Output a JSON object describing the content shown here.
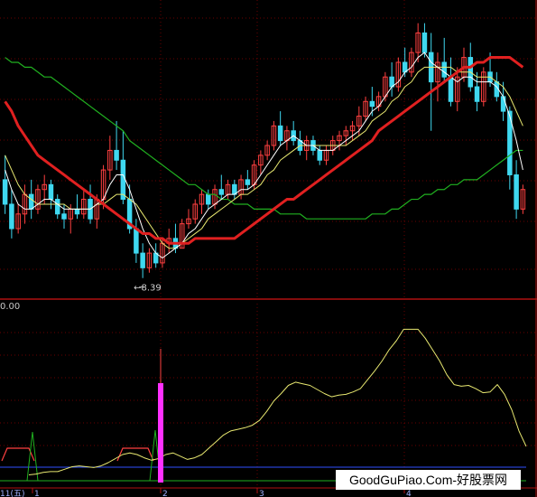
{
  "colors": {
    "up": "#ff4040",
    "down": "#3fd8f0",
    "ma_fast": "#ffffff",
    "ma_mid": "#e8e870",
    "ma_thick": "#e02020",
    "ma_long": "#20b020",
    "ind_line": "#e8e870",
    "ind_spike": "#ff30ff",
    "ind_red": "#ff4040",
    "ind_green": "#20b020",
    "grid": "#6a0000",
    "divider": "#b01010",
    "blue": "#3050ff"
  },
  "main": {
    "min_price_label": "8.39"
  },
  "indicator": {
    "value_label": "0.00"
  },
  "axis": {
    "left_label": "11(五)",
    "ticks": [
      "1",
      "2",
      "3",
      "4"
    ]
  },
  "watermark": "GoodGuPiao.Com-好股票网",
  "chart_data": [
    {
      "type": "candlestick",
      "candles": [
        [
          10.4,
          10.9,
          9.7,
          9.9
        ],
        [
          9.9,
          10.2,
          9.2,
          9.4
        ],
        [
          9.4,
          9.9,
          9.3,
          9.7
        ],
        [
          9.7,
          10.3,
          9.5,
          10.1
        ],
        [
          10.1,
          10.4,
          9.6,
          9.8
        ],
        [
          9.8,
          10.3,
          9.7,
          10.2
        ],
        [
          10.2,
          10.5,
          9.9,
          10.3
        ],
        [
          10.3,
          10.4,
          9.8,
          10.0
        ],
        [
          10.0,
          10.1,
          9.6,
          9.7
        ],
        [
          9.7,
          9.9,
          9.4,
          9.6
        ],
        [
          9.6,
          9.9,
          9.3,
          9.8
        ],
        [
          9.8,
          10.1,
          9.6,
          9.7
        ],
        [
          9.7,
          10.2,
          9.6,
          10.0
        ],
        [
          10.0,
          10.3,
          9.5,
          9.6
        ],
        [
          9.6,
          10.1,
          9.4,
          10.0
        ],
        [
          10.0,
          10.7,
          9.8,
          10.6
        ],
        [
          10.6,
          11.3,
          10.4,
          11.0
        ],
        [
          11.0,
          11.6,
          10.6,
          10.8
        ],
        [
          10.8,
          11.4,
          9.9,
          10.0
        ],
        [
          10.0,
          10.3,
          9.3,
          9.4
        ],
        [
          9.4,
          9.6,
          8.7,
          8.9
        ],
        [
          8.9,
          9.1,
          8.39,
          8.6
        ],
        [
          8.6,
          9.0,
          8.5,
          8.9
        ],
        [
          8.9,
          9.1,
          8.6,
          8.7
        ],
        [
          8.7,
          9.2,
          8.6,
          9.1
        ],
        [
          9.1,
          9.4,
          8.9,
          9.2
        ],
        [
          9.2,
          9.5,
          8.9,
          9.0
        ],
        [
          9.0,
          9.6,
          9.0,
          9.5
        ],
        [
          9.5,
          9.8,
          9.4,
          9.6
        ],
        [
          9.6,
          10.0,
          9.5,
          9.9
        ],
        [
          9.9,
          10.2,
          9.7,
          10.1
        ],
        [
          10.1,
          10.2,
          9.8,
          9.9
        ],
        [
          9.9,
          10.3,
          9.8,
          10.2
        ],
        [
          10.2,
          10.5,
          10.0,
          10.1
        ],
        [
          10.1,
          10.4,
          10.0,
          10.3
        ],
        [
          10.3,
          10.4,
          10.0,
          10.1
        ],
        [
          10.1,
          10.5,
          10.0,
          10.4
        ],
        [
          10.4,
          10.6,
          10.2,
          10.3
        ],
        [
          10.3,
          10.8,
          10.2,
          10.7
        ],
        [
          10.7,
          11.0,
          10.5,
          10.9
        ],
        [
          10.9,
          11.2,
          10.8,
          11.1
        ],
        [
          11.1,
          11.6,
          11.0,
          11.5
        ],
        [
          11.5,
          11.8,
          11.1,
          11.2
        ],
        [
          11.2,
          11.5,
          11.0,
          11.4
        ],
        [
          11.4,
          11.6,
          11.1,
          11.2
        ],
        [
          11.2,
          11.4,
          10.9,
          11.0
        ],
        [
          11.0,
          11.3,
          10.8,
          11.2
        ],
        [
          11.2,
          11.3,
          10.9,
          11.0
        ],
        [
          11.0,
          11.1,
          10.7,
          10.8
        ],
        [
          10.8,
          11.1,
          10.7,
          11.0
        ],
        [
          11.0,
          11.3,
          10.9,
          11.2
        ],
        [
          11.2,
          11.4,
          11.0,
          11.3
        ],
        [
          11.3,
          11.5,
          11.1,
          11.4
        ],
        [
          11.4,
          11.6,
          11.2,
          11.5
        ],
        [
          11.5,
          11.9,
          11.3,
          11.7
        ],
        [
          11.7,
          12.1,
          11.6,
          12.0
        ],
        [
          12.0,
          12.3,
          11.7,
          11.9
        ],
        [
          11.9,
          12.2,
          11.8,
          12.1
        ],
        [
          12.1,
          12.6,
          12.0,
          12.5
        ],
        [
          12.5,
          12.8,
          12.1,
          12.3
        ],
        [
          12.3,
          12.9,
          12.2,
          12.8
        ],
        [
          12.8,
          13.1,
          12.5,
          12.6
        ],
        [
          12.6,
          13.1,
          12.5,
          13.0
        ],
        [
          13.0,
          13.6,
          12.8,
          13.4
        ],
        [
          13.4,
          13.6,
          12.9,
          13.0
        ],
        [
          13.0,
          13.4,
          11.4,
          12.4
        ],
        [
          12.4,
          13.0,
          12.0,
          12.8
        ],
        [
          12.8,
          13.3,
          12.4,
          12.5
        ],
        [
          12.5,
          12.9,
          11.9,
          12.0
        ],
        [
          12.0,
          12.7,
          11.8,
          12.5
        ],
        [
          12.5,
          13.1,
          12.4,
          12.9
        ],
        [
          12.9,
          13.2,
          12.2,
          12.3
        ],
        [
          12.3,
          12.6,
          11.8,
          12.0
        ],
        [
          12.0,
          12.7,
          11.9,
          12.6
        ],
        [
          12.6,
          13.0,
          12.3,
          12.4
        ],
        [
          12.4,
          12.6,
          12.0,
          12.1
        ],
        [
          12.1,
          12.4,
          11.6,
          11.8
        ],
        [
          11.8,
          11.9,
          10.2,
          10.5
        ],
        [
          10.5,
          10.8,
          9.6,
          9.8
        ],
        [
          9.8,
          10.3,
          9.7,
          10.2
        ]
      ],
      "ma_fast": [
        10.6,
        10.2,
        9.9,
        9.8,
        9.8,
        9.9,
        10.0,
        10.0,
        9.9,
        9.8,
        9.8,
        9.8,
        9.8,
        9.8,
        9.9,
        10.0,
        10.3,
        10.5,
        10.5,
        10.2,
        9.8,
        9.4,
        9.1,
        8.9,
        8.8,
        8.9,
        9.0,
        9.1,
        9.3,
        9.4,
        9.6,
        9.8,
        9.9,
        10.0,
        10.1,
        10.1,
        10.2,
        10.2,
        10.3,
        10.5,
        10.7,
        10.9,
        11.1,
        11.2,
        11.3,
        11.2,
        11.1,
        11.1,
        11.0,
        11.0,
        11.0,
        11.1,
        11.2,
        11.3,
        11.4,
        11.6,
        11.8,
        11.9,
        12.1,
        12.3,
        12.4,
        12.6,
        12.7,
        12.9,
        13.0,
        12.8,
        12.7,
        12.6,
        12.5,
        12.4,
        12.5,
        12.5,
        12.4,
        12.4,
        12.4,
        12.3,
        12.1,
        11.7,
        11.2,
        10.6
      ],
      "ma_mid": [
        10.9,
        10.6,
        10.3,
        10.1,
        10.0,
        9.9,
        9.9,
        9.9,
        9.9,
        9.9,
        9.8,
        9.8,
        9.8,
        9.8,
        9.9,
        9.9,
        10.0,
        10.1,
        10.1,
        10.0,
        9.9,
        9.7,
        9.5,
        9.3,
        9.1,
        9.0,
        9.0,
        9.1,
        9.2,
        9.3,
        9.4,
        9.6,
        9.7,
        9.8,
        9.9,
        10.0,
        10.1,
        10.1,
        10.2,
        10.3,
        10.5,
        10.6,
        10.8,
        10.9,
        11.0,
        11.1,
        11.1,
        11.1,
        11.1,
        11.1,
        11.1,
        11.1,
        11.1,
        11.2,
        11.3,
        11.4,
        11.6,
        11.7,
        11.8,
        12.0,
        12.1,
        12.3,
        12.4,
        12.6,
        12.7,
        12.7,
        12.7,
        12.7,
        12.7,
        12.6,
        12.6,
        12.6,
        12.5,
        12.5,
        12.5,
        12.4,
        12.3,
        12.1,
        11.8,
        11.5
      ],
      "ma_thick": [
        12.0,
        11.8,
        11.5,
        11.3,
        11.1,
        10.9,
        10.8,
        10.7,
        10.6,
        10.5,
        10.4,
        10.3,
        10.2,
        10.1,
        10.0,
        9.9,
        9.8,
        9.7,
        9.6,
        9.5,
        9.4,
        9.3,
        9.3,
        9.2,
        9.2,
        9.1,
        9.1,
        9.1,
        9.1,
        9.2,
        9.2,
        9.2,
        9.2,
        9.2,
        9.2,
        9.2,
        9.3,
        9.4,
        9.5,
        9.6,
        9.7,
        9.8,
        9.9,
        10.0,
        10.0,
        10.1,
        10.2,
        10.3,
        10.4,
        10.5,
        10.6,
        10.7,
        10.8,
        10.9,
        11.0,
        11.1,
        11.2,
        11.4,
        11.5,
        11.6,
        11.7,
        11.8,
        11.9,
        12.0,
        12.1,
        12.2,
        12.3,
        12.4,
        12.5,
        12.6,
        12.7,
        12.7,
        12.8,
        12.8,
        12.9,
        12.9,
        12.9,
        12.9,
        12.8,
        12.7
      ],
      "ma_long": [
        12.9,
        12.8,
        12.8,
        12.7,
        12.7,
        12.6,
        12.5,
        12.5,
        12.4,
        12.3,
        12.2,
        12.1,
        12.0,
        11.9,
        11.8,
        11.7,
        11.6,
        11.5,
        11.4,
        11.2,
        11.1,
        11.0,
        10.9,
        10.8,
        10.7,
        10.6,
        10.5,
        10.4,
        10.3,
        10.3,
        10.2,
        10.1,
        10.1,
        10.0,
        10.0,
        9.9,
        9.9,
        9.9,
        9.8,
        9.8,
        9.8,
        9.8,
        9.7,
        9.7,
        9.7,
        9.7,
        9.6,
        9.6,
        9.6,
        9.6,
        9.6,
        9.6,
        9.6,
        9.6,
        9.6,
        9.6,
        9.7,
        9.7,
        9.7,
        9.8,
        9.8,
        9.9,
        10.0,
        10.0,
        10.1,
        10.1,
        10.2,
        10.2,
        10.3,
        10.3,
        10.4,
        10.4,
        10.4,
        10.5,
        10.6,
        10.7,
        10.8,
        10.9,
        11.0,
        11.0
      ],
      "ylim": [
        8.2,
        14.0
      ]
    },
    {
      "type": "line",
      "line": [
        0.5,
        0.6,
        0.8,
        0.9,
        0.9,
        1.2,
        1.5,
        1.6,
        1.5,
        1.4,
        1.6,
        2.0,
        2.5,
        3.0,
        3.2,
        3.0,
        2.6,
        2.3,
        2.5,
        3.0,
        3.2,
        2.8,
        2.4,
        2.6,
        3.0,
        3.8,
        4.6,
        5.4,
        5.9,
        6.1,
        6.3,
        6.6,
        7.2,
        8.3,
        9.6,
        10.5,
        11.5,
        11.9,
        11.7,
        11.5,
        11.0,
        10.5,
        10.1,
        10.3,
        10.4,
        10.7,
        11.1,
        12.2,
        13.3,
        14.5,
        15.9,
        17.0,
        18.4,
        18.4,
        18.4,
        17.3,
        15.9,
        14.5,
        12.8,
        11.6,
        11.4,
        11.5,
        11.1,
        10.6,
        10.7,
        11.6,
        10.4,
        8.5,
        5.9,
        4.0
      ],
      "spike_index": 17,
      "spike_value": 12.0,
      "ylim": [
        0,
        20
      ]
    }
  ]
}
